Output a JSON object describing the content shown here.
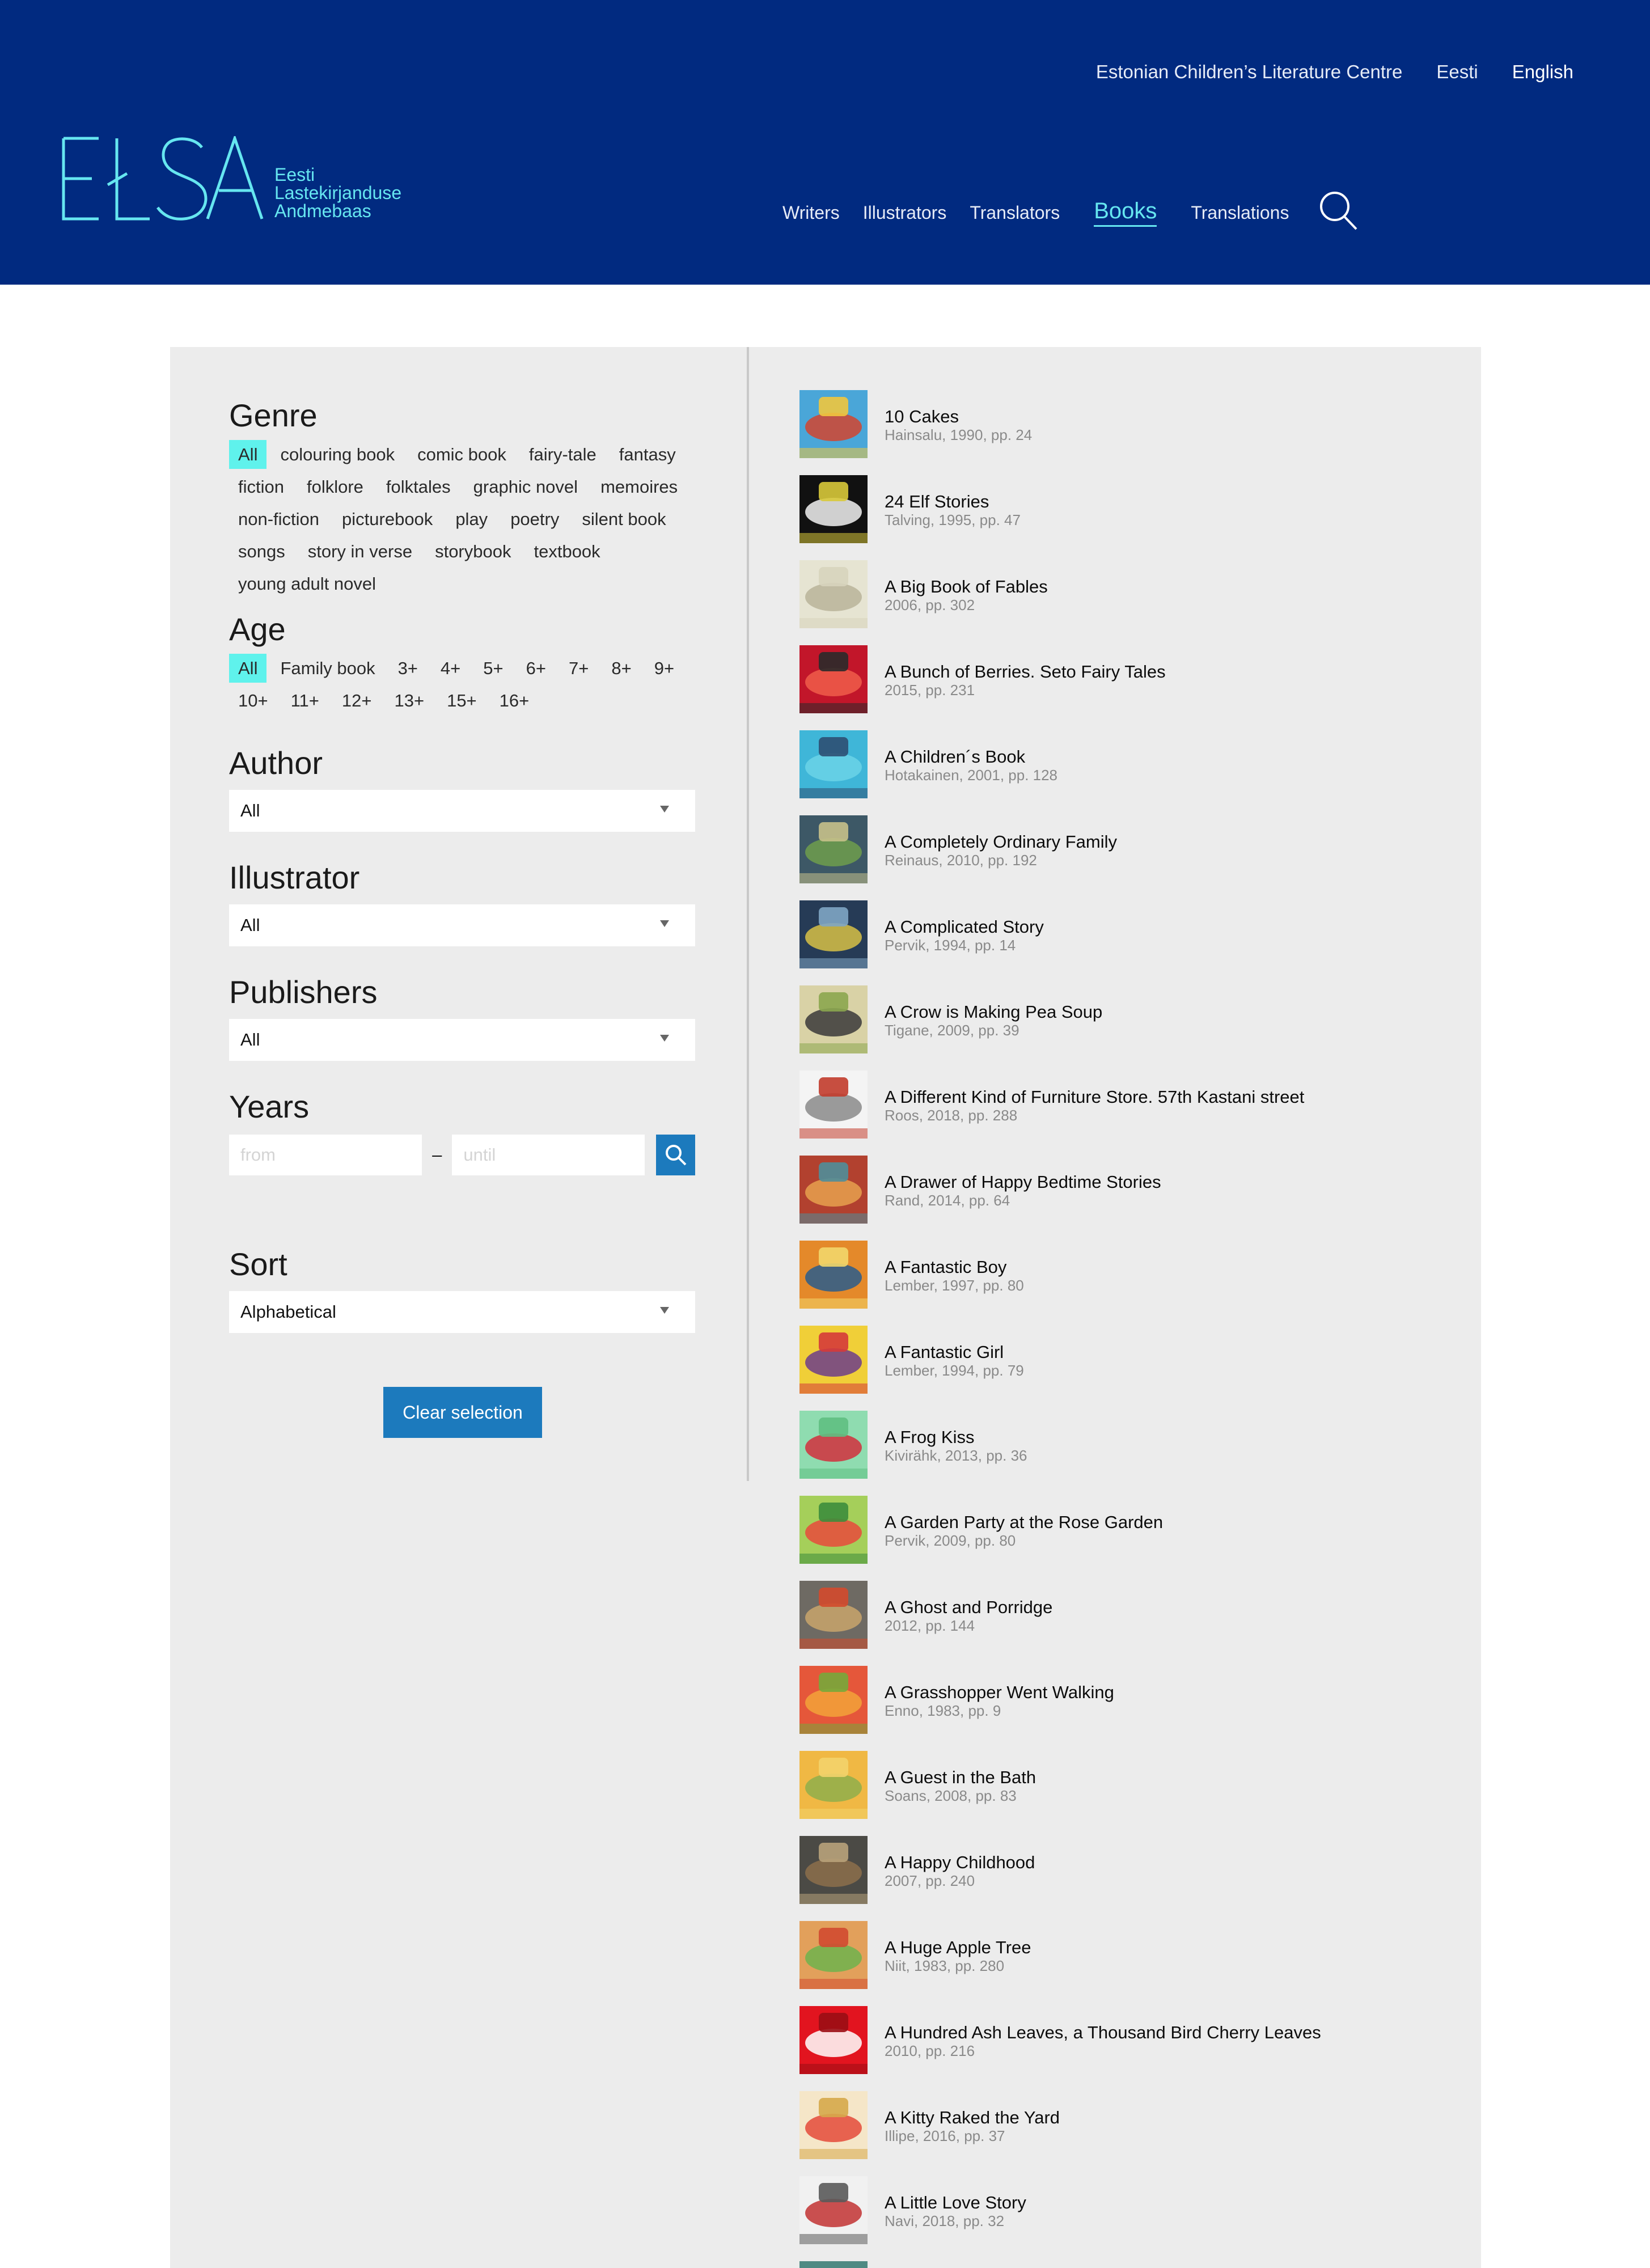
{
  "top_links": {
    "centre": "Estonian Children’s Literature Centre",
    "lang_et": "Eesti",
    "lang_en": "English"
  },
  "logo": {
    "word": "ELSA",
    "line1": "Eesti",
    "line2": "Lastekirjanduse",
    "line3": "Andmebaas"
  },
  "nav": {
    "writers": "Writers",
    "illustrators": "Illustrators",
    "translators": "Translators",
    "books": "Books",
    "translations": "Translations"
  },
  "filters": {
    "genre": {
      "heading": "Genre",
      "tags": [
        "All",
        "colouring book",
        "comic book",
        "fairy-tale",
        "fantasy",
        "fiction",
        "folklore",
        "folktales",
        "graphic novel",
        "memoires",
        "non-fiction",
        "picturebook",
        "play",
        "poetry",
        "silent book",
        "songs",
        "story in verse",
        "storybook",
        "textbook",
        "young adult novel"
      ]
    },
    "age": {
      "heading": "Age",
      "tags": [
        "All",
        "Family book",
        "3+",
        "4+",
        "5+",
        "6+",
        "7+",
        "8+",
        "9+",
        "10+",
        "11+",
        "12+",
        "13+",
        "15+",
        "16+"
      ]
    },
    "author": {
      "heading": "Author",
      "value": "All"
    },
    "illustrator": {
      "heading": "Illustrator",
      "value": "All"
    },
    "publishers": {
      "heading": "Publishers",
      "value": "All"
    },
    "years": {
      "heading": "Years",
      "from_placeholder": "from",
      "until_placeholder": "until",
      "dash": "–"
    },
    "sort": {
      "heading": "Sort",
      "value": "Alphabetical"
    },
    "clear_label": "Clear selection"
  },
  "books": [
    {
      "title": "10 Cakes",
      "meta": "Hainsalu, 1990, pp. 24",
      "colors": [
        "#4aa6d8",
        "#d2442f",
        "#f0c63e"
      ]
    },
    {
      "title": "24 Elf Stories",
      "meta": "Talving, 1995, pp. 47",
      "colors": [
        "#111111",
        "#f2f2f2",
        "#d8c93a"
      ]
    },
    {
      "title": "A Big Book of Fables",
      "meta": "2006, pp. 302",
      "colors": [
        "#e6e4d2",
        "#b9b49a",
        "#d7d4bc"
      ]
    },
    {
      "title": "A Bunch of Berries. Seto Fairy Tales",
      "meta": "2015, pp. 231",
      "colors": [
        "#c2162a",
        "#f05d4a",
        "#2a2a2a"
      ]
    },
    {
      "title": "A Children´s Book",
      "meta": "Hotakainen, 2001, pp. 128",
      "colors": [
        "#3fb6d8",
        "#6bd3e8",
        "#2d4f73"
      ]
    },
    {
      "title": "A Completely Ordinary Family",
      "meta": "Reinaus, 2010, pp. 192",
      "colors": [
        "#3d5866",
        "#6e9d4c",
        "#c6c18a"
      ]
    },
    {
      "title": "A Complicated Story",
      "meta": "Pervik, 1994, pp. 14",
      "colors": [
        "#263b56",
        "#d7c145",
        "#7fa6c4"
      ]
    },
    {
      "title": "A Crow is Making Pea Soup",
      "meta": "Tigane, 2009, pp. 39",
      "colors": [
        "#d9d2a6",
        "#3a3a3a",
        "#8ba64f"
      ]
    },
    {
      "title": "A Different Kind of Furniture Store. 57th Kastani street",
      "meta": "Roos, 2018, pp. 288",
      "colors": [
        "#f4f4f4",
        "#8a8a8a",
        "#c23c2c"
      ]
    },
    {
      "title": "A Drawer of Happy Bedtime Stories",
      "meta": "Rand, 2014, pp. 64",
      "colors": [
        "#b2412f",
        "#e6a14d",
        "#4f8e9a"
      ]
    },
    {
      "title": "A Fantastic Boy",
      "meta": "Lember, 1997, pp. 80",
      "colors": [
        "#e4892a",
        "#2a5d8c",
        "#f2d76a"
      ]
    },
    {
      "title": "A Fantastic Girl",
      "meta": "Lember, 1994, pp. 79",
      "colors": [
        "#f0cf38",
        "#6d3d8a",
        "#d53a3a"
      ]
    },
    {
      "title": "A Frog Kiss",
      "meta": "Kivirähk, 2013, pp. 36",
      "colors": [
        "#8fdcb0",
        "#d22f3d",
        "#5fbf82"
      ]
    },
    {
      "title": "A Garden Party at the Rose Garden",
      "meta": "Pervik, 2009, pp. 80",
      "colors": [
        "#a5cf5a",
        "#e84a3c",
        "#3d8d3c"
      ]
    },
    {
      "title": "A Ghost and Porridge",
      "meta": "2012, pp. 144",
      "colors": [
        "#6e6a63",
        "#c9a56b",
        "#d34a2c"
      ]
    },
    {
      "title": "A Grasshopper Went Walking",
      "meta": "Enno, 1983, pp. 9",
      "colors": [
        "#e5573a",
        "#f3a23a",
        "#77a83b"
      ]
    },
    {
      "title": "A Guest in the Bath",
      "meta": "Soans, 2008, pp. 83",
      "colors": [
        "#f0b844",
        "#8fae4b",
        "#f3d36b"
      ]
    },
    {
      "title": "A Happy Childhood",
      "meta": "2007, pp. 240",
      "colors": [
        "#4b4a45",
        "#8c6f4b",
        "#b8a27a"
      ]
    },
    {
      "title": "A Huge Apple Tree",
      "meta": "Niit, 1983, pp. 280",
      "colors": [
        "#e2a05b",
        "#6fb34d",
        "#d14a30"
      ]
    },
    {
      "title": "A Hundred Ash Leaves, a Thousand Bird Cherry Leaves",
      "meta": "2010, pp. 216",
      "colors": [
        "#e2141f",
        "#ffffff",
        "#9b0d14"
      ]
    },
    {
      "title": "A Kitty Raked the Yard",
      "meta": "Illipe, 2016, pp. 37",
      "colors": [
        "#f5e6c8",
        "#e44a3a",
        "#d6a84a"
      ]
    },
    {
      "title": "A Little Love Story",
      "meta": "Navi, 2018, pp. 32",
      "colors": [
        "#f1f1f1",
        "#c23232",
        "#5a5a5a"
      ]
    },
    {
      "title": "",
      "meta": "",
      "colors": [
        "#4f8a83",
        "#3b6d66",
        "#6fa79f"
      ]
    }
  ]
}
